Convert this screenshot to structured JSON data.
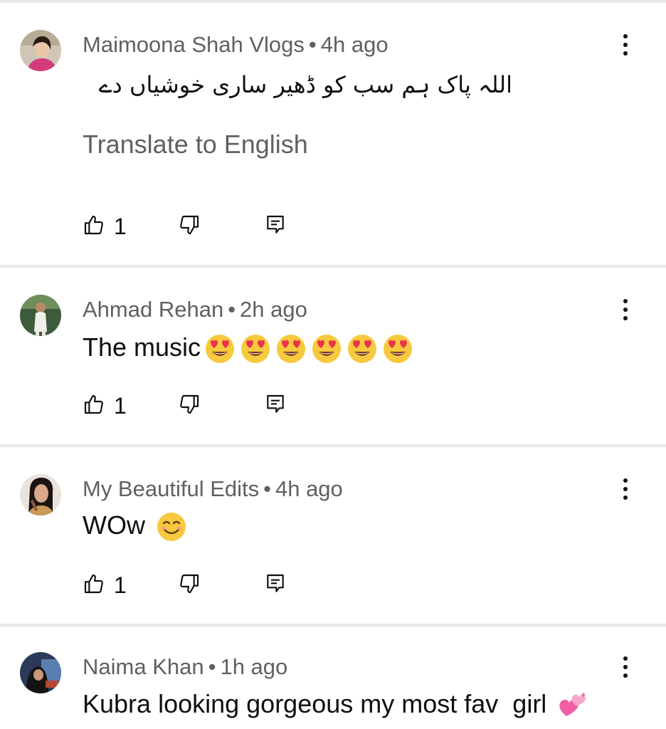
{
  "comments": [
    {
      "author": "Maimoona Shah Vlogs",
      "time": "4h ago",
      "text": "اللہ پاک ہم سب کو ڈھیر ساری خوشیاں دے",
      "translate_label": "Translate to English",
      "likes": "1"
    },
    {
      "author": "Ahmad Rehan",
      "time": "2h ago",
      "text": "The music",
      "emoji_count": 6,
      "emoji": "heart-eyes-emoji",
      "likes": "1"
    },
    {
      "author": "My Beautiful Edits",
      "time": "4h ago",
      "text": "WOw",
      "emoji": "smiling-face-emoji",
      "likes": "1"
    },
    {
      "author": "Naima Khan",
      "time": "1h ago",
      "text": "Kubra looking gorgeous my most fav  girl",
      "emoji": "two-hearts-emoji"
    }
  ],
  "separator": "•",
  "icons": {
    "like": "thumbs-up-icon",
    "dislike": "thumbs-down-icon",
    "reply": "reply-icon",
    "menu": "more-vertical-icon"
  },
  "colors": {
    "text_primary": "#0f0f0f",
    "text_secondary": "#606060",
    "divider": "#e8e8e8"
  }
}
